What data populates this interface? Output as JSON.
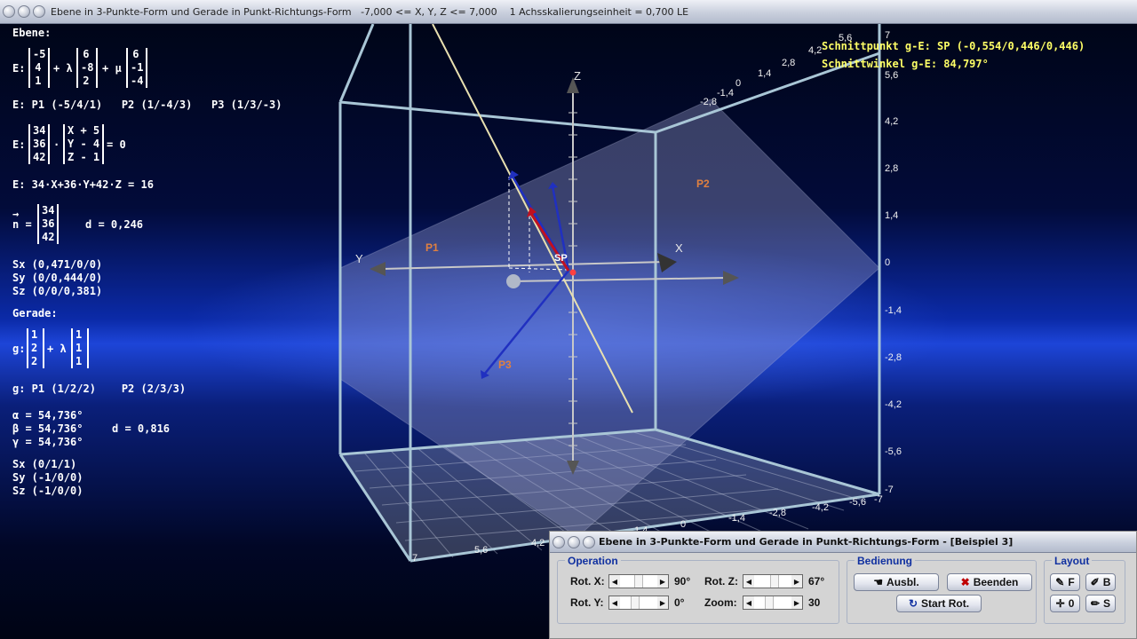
{
  "window": {
    "title": "Ebene in 3-Punkte-Form und Gerade in Punkt-Richtungs-Form   -7,000 <= X, Y, Z <= 7,000    1 Achsskalierungseinheit = 0,700 LE"
  },
  "left_panel": {
    "ebene_header": "Ebene:",
    "e_label": "E:",
    "v1": [
      "-5",
      "4",
      "1"
    ],
    "plus_lambda": "+ λ",
    "v2": [
      "6",
      "-8",
      "2"
    ],
    "plus_mu": "+ μ",
    "v3": [
      "6",
      "-1",
      "-4"
    ],
    "points_line": "E: P1 (-5/4/1)   P2 (1/-4/3)   P3 (1/3/-3)",
    "e_label2": "E:",
    "normal_vec": [
      "34",
      "36",
      "42"
    ],
    "dot": "·",
    "xyz_vec": [
      "X + 5",
      "Y - 4",
      "Z - 1"
    ],
    "eq_zero": "= 0",
    "coord_form": "E: 34·X+36·Y+42·Z = 16",
    "n_arrow": "→",
    "n_label": "n =",
    "n_vec": [
      "34",
      "36",
      "42"
    ],
    "d_plane": "d = 0,246",
    "sx": "Sx (0,471/0/0)",
    "sy": "Sy (0/0,444/0)",
    "sz": "Sz (0/0/0,381)",
    "gerade_header": "Gerade:",
    "g_label": "g:",
    "g_v1": [
      "1",
      "2",
      "2"
    ],
    "g_plus_lambda": "+ λ",
    "g_v2": [
      "1",
      "1",
      "1"
    ],
    "g_points": "g: P1 (1/2/2)    P2 (2/3/3)",
    "alpha": "α = 54,736°",
    "beta": "β = 54,736°",
    "gamma": "γ = 54,736°",
    "d_line": "d = 0,816",
    "g_sx": "Sx (0/1/1)",
    "g_sy": "Sy (-1/0/0)",
    "g_sz": "Sz (-1/0/0)"
  },
  "hud": {
    "schnittpunkt": "Schnittpunkt g-E: SP (-0,554/0,446/0,446)",
    "schnittwinkel": "Schnittwinkel g-E: 84,797°"
  },
  "scene": {
    "axis_x": "X",
    "axis_y": "Y",
    "axis_z": "Z",
    "p1": "P1",
    "p2": "P2",
    "p3": "P3",
    "sp": "SP",
    "right_ticks": [
      "7",
      "5,6",
      "4,2",
      "2,8",
      "1,4",
      "0",
      "-1,4",
      "-2,8",
      "-4,2",
      "-5,6",
      "-7"
    ],
    "top_ticks": [
      "5,6",
      "4,2",
      "2,8",
      "1,4",
      "0",
      "-1,4",
      "-2,8"
    ],
    "bottom_ticks": [
      "7",
      "5,6",
      "4,2",
      "1,4",
      "0",
      "-1,4",
      "-2,8",
      "-4,2",
      "-5,6",
      "-7"
    ]
  },
  "control_panel": {
    "title": "Ebene in 3-Punkte-Form und Gerade in Punkt-Richtungs-Form - [Beispiel 3]",
    "operation_title": "Operation",
    "rot_x_label": "Rot. X:",
    "rot_x_value": "90°",
    "rot_y_label": "Rot. Y:",
    "rot_y_value": "0°",
    "rot_z_label": "Rot. Z:",
    "rot_z_value": "67°",
    "zoom_label": "Zoom:",
    "zoom_value": "30",
    "bedienung_title": "Bedienung",
    "ausbl_label": "Ausbl.",
    "beenden_label": "Beenden",
    "start_rot_label": "Start Rot.",
    "layout_title": "Layout",
    "layout_f": "F",
    "layout_b": "B",
    "layout_o": "0",
    "layout_s": "S"
  }
}
